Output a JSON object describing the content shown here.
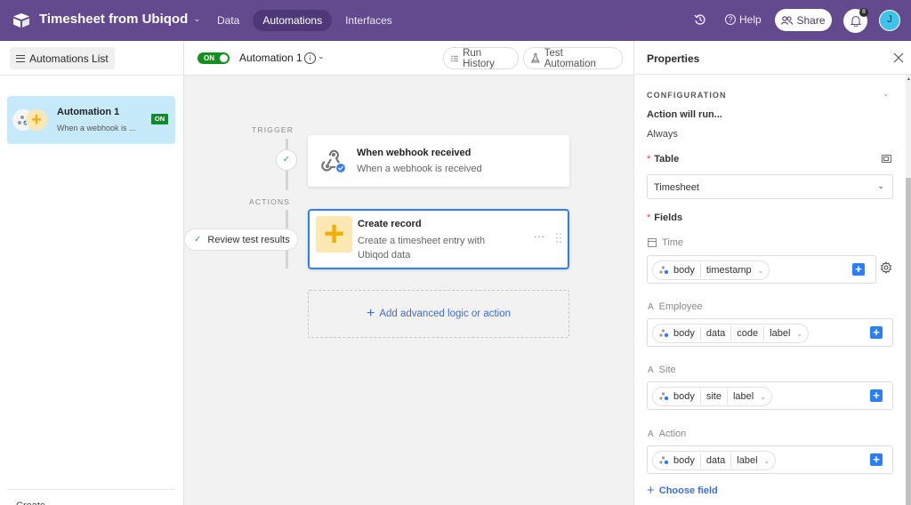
{
  "topbar": {
    "base_title": "Timesheet from Ubiqod",
    "nav": [
      {
        "label": "Data",
        "active": false
      },
      {
        "label": "Automations",
        "active": true
      },
      {
        "label": "Interfaces",
        "active": false
      }
    ],
    "help_label": "Help",
    "share_label": "Share",
    "notification_count": "8",
    "avatar_initial": "J",
    "brand_color": "#63498d"
  },
  "sidebar": {
    "list_button_label": "Automations List",
    "automations": [
      {
        "name": "Automation 1",
        "description": "When a webhook is ...",
        "status": "ON",
        "selected": true
      }
    ],
    "footer_label": "Create"
  },
  "canvas": {
    "toggle_label": "ON",
    "automation_title": "Automation 1",
    "run_history_label": "Run History",
    "test_automation_label": "Test Automation",
    "trigger_section_label": "TRIGGER",
    "actions_section_label": "ACTIONS",
    "review_label": "Review test results",
    "trigger": {
      "title": "When webhook received",
      "description": "When a webhook is received"
    },
    "action": {
      "title": "Create record",
      "description": "Create a timesheet entry with Ubiqod data"
    },
    "add_logic_label": "Add advanced logic or action"
  },
  "panel": {
    "title": "Properties",
    "section_title": "CONFIGURATION",
    "run_label": "Action will run...",
    "run_value": "Always",
    "table_label": "Table",
    "table_value": "Timesheet",
    "fields_label": "Fields",
    "fields": [
      {
        "name": "Time",
        "icon": "calendar-icon",
        "tokens": [
          "body",
          "timestamp"
        ]
      },
      {
        "name": "Employee",
        "icon": "text-icon",
        "tokens": [
          "body",
          "data",
          "code",
          "label"
        ]
      },
      {
        "name": "Site",
        "icon": "text-icon",
        "tokens": [
          "body",
          "site",
          "label"
        ]
      },
      {
        "name": "Action",
        "icon": "text-icon",
        "tokens": [
          "body",
          "data",
          "label"
        ]
      }
    ],
    "choose_field_label": "Choose field",
    "accent_color": "#2d7ff9"
  }
}
